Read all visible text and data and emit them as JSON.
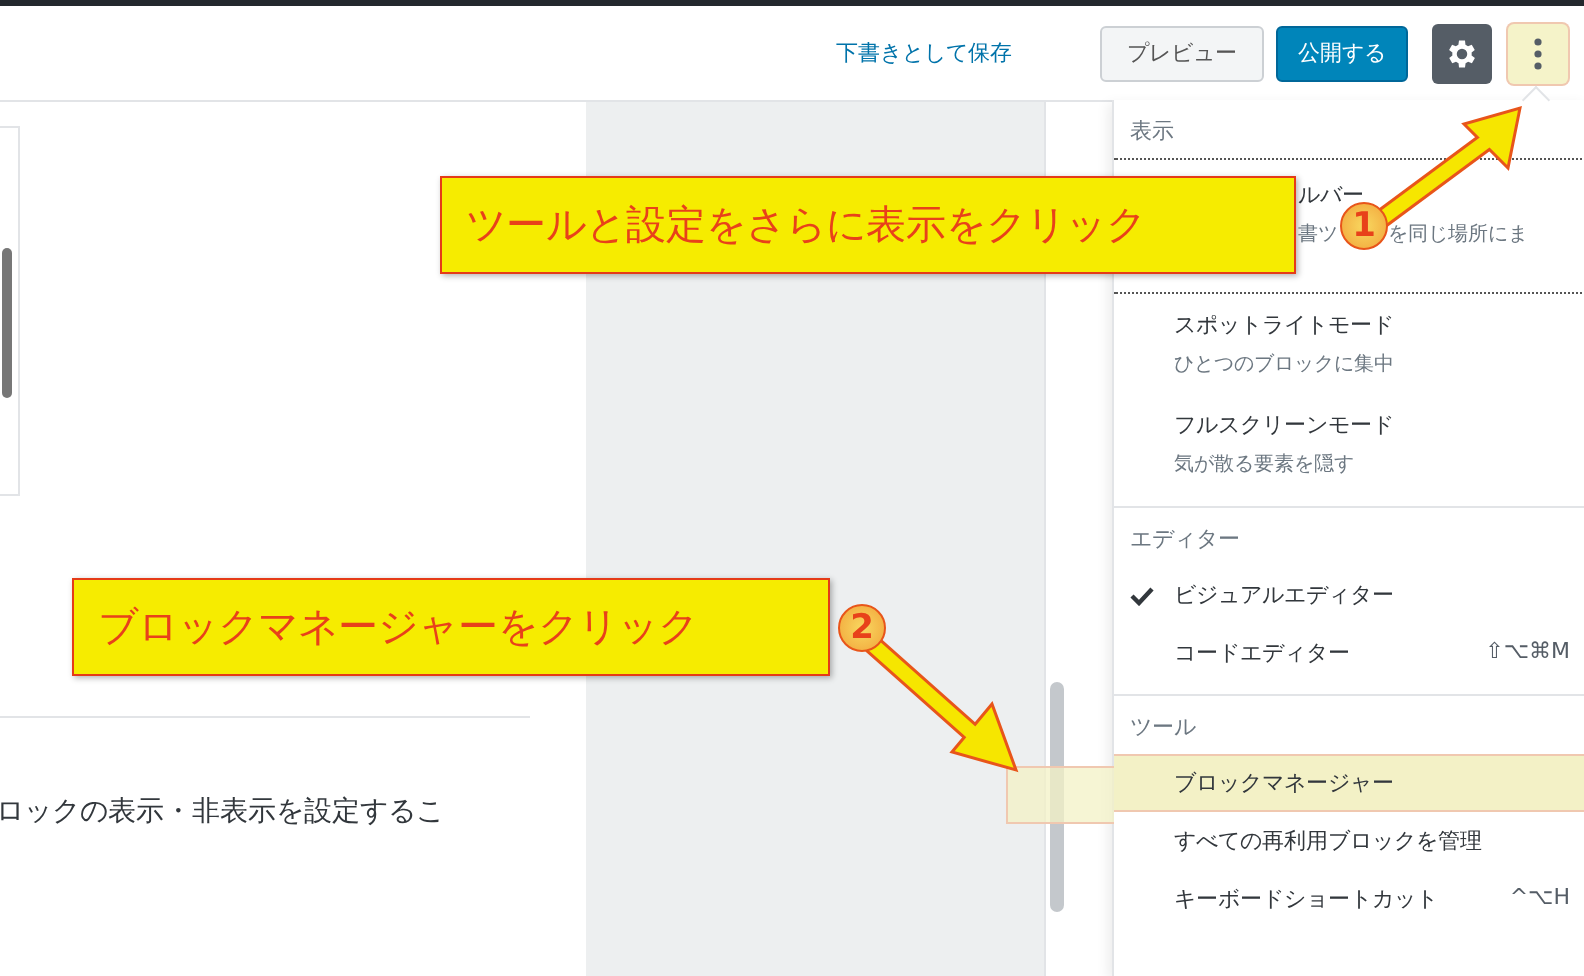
{
  "topbar": {
    "save_draft": "下書きとして保存",
    "preview": "プレビュー",
    "publish": "公開する",
    "settings_button": {
      "pressed": true
    },
    "more_button": {
      "highlighted": true
    }
  },
  "editor": {
    "paragraph": "ロックの表示・非表示を設定するこ"
  },
  "menu": {
    "groups": [
      {
        "heading": "表示",
        "items": [
          {
            "label": "ルバー",
            "description_parts": [
              "書ツ",
              "を同じ場所にま"
            ],
            "focused": true
          },
          {
            "label": "スポットライトモード",
            "description": "ひとつのブロックに集中",
            "focused": false
          },
          {
            "label": "フルスクリーンモード",
            "description": "気が散る要素を隠す",
            "focused": false
          }
        ]
      },
      {
        "heading": "エディター",
        "items": [
          {
            "label": "ビジュアルエディター",
            "selected": true
          },
          {
            "label": "コードエディター",
            "shortcut": "⇧⌥⌘M",
            "selected": false
          }
        ]
      },
      {
        "heading": "ツール",
        "items": [
          {
            "label": "ブロックマネージャー",
            "highlighted": true
          },
          {
            "label": "すべての再利用ブロックを管理",
            "highlighted": false
          },
          {
            "label": "キーボードショートカット",
            "shortcut": "^⌥H",
            "highlighted": false
          }
        ]
      }
    ]
  },
  "annotations": [
    {
      "number": "1",
      "text": "ツールと設定をさらに表示をクリック"
    },
    {
      "number": "2",
      "text": "ブロックマネージャーをクリック"
    }
  ]
}
